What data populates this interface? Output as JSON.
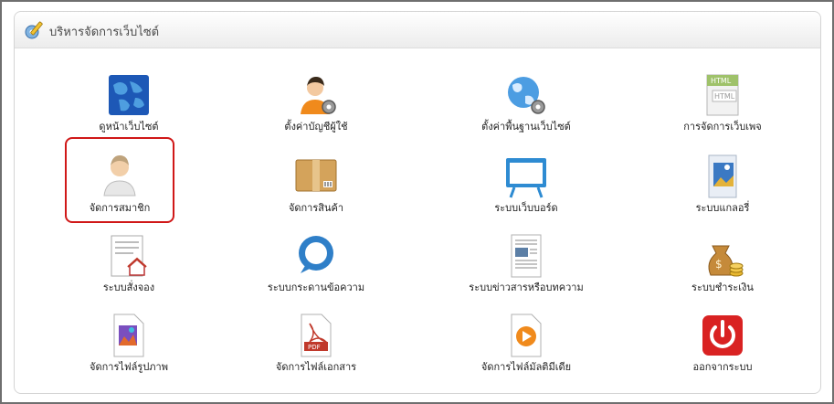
{
  "panel": {
    "title": "บริหารจัดการเว็บไซต์"
  },
  "tiles": [
    {
      "label": "ดูหน้าเว็บไซต์",
      "icon": "globe-icon"
    },
    {
      "label": "ตั้งค่าบัญชีผู้ใช้",
      "icon": "user-settings-icon"
    },
    {
      "label": "ตั้งค่าพื้นฐานเว็บไซต์",
      "icon": "globe-settings-icon"
    },
    {
      "label": "การจัดการเว็บเพจ",
      "icon": "html-page-icon"
    },
    {
      "label": "จัดการสมาชิก",
      "icon": "member-icon",
      "selected": true
    },
    {
      "label": "จัดการสินค้า",
      "icon": "product-box-icon"
    },
    {
      "label": "ระบบเว็บบอร์ด",
      "icon": "webboard-icon"
    },
    {
      "label": "ระบบแกลอรี่",
      "icon": "gallery-icon"
    },
    {
      "label": "ระบบสั่งจอง",
      "icon": "booking-icon"
    },
    {
      "label": "ระบบกระดานข้อความ",
      "icon": "message-board-icon"
    },
    {
      "label": "ระบบข่าวสารหรือบทความ",
      "icon": "news-article-icon"
    },
    {
      "label": "ระบบชำระเงิน",
      "icon": "payment-icon"
    },
    {
      "label": "จัดการไฟล์รูปภาพ",
      "icon": "image-file-icon"
    },
    {
      "label": "จัดการไฟล์เอกสาร",
      "icon": "pdf-file-icon"
    },
    {
      "label": "จัดการไฟล์มัลติมีเดีย",
      "icon": "media-file-icon"
    },
    {
      "label": "ออกจากระบบ",
      "icon": "power-icon"
    }
  ],
  "colors": {
    "selection_outline": "#d01818",
    "frame": "#6f6f6f"
  }
}
